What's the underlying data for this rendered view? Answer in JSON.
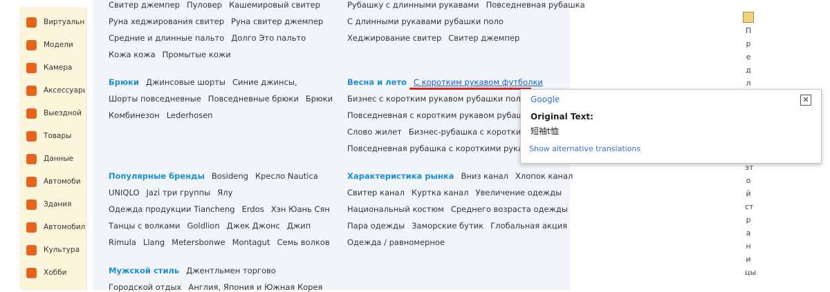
{
  "sidebar": [
    "Виртуальн",
    "Модели",
    "Камера",
    "Аксессуары",
    "Выездной",
    "Товары",
    "Данные",
    "Автомоби",
    "Здания",
    "Автомобили",
    "Культура",
    "Хобби"
  ],
  "main": {
    "left_rows": [
      [
        "Свитер джемпер",
        "Пуловер",
        "Кашемировый свитер"
      ],
      [
        "Руна хеджирования свитер",
        "Руна свитер джемпер"
      ],
      [
        "Средние и длинные пальто",
        "Долго Это пальто"
      ],
      [
        "Кожа кожа",
        "Промытые кожи"
      ],
      [
        "Брюки",
        "Джинсовые шорты",
        "Синие джинсы,"
      ],
      [
        "Шорты повседневные",
        "Повседневные брюки",
        "Брюки"
      ],
      [
        "Комбинезон",
        "Lederhosen"
      ],
      [
        "Популярные бренды",
        "Bosideng",
        "Кресло Nautica"
      ],
      [
        "UNIQLO",
        "Jazi три группы",
        "Ялу"
      ],
      [
        "Одежда продукции Tiancheng",
        "Erdos",
        "Хэн Юань Сян"
      ],
      [
        "Танцы с волками",
        "Goldlion",
        "Джек Джонс",
        "Джип"
      ],
      [
        "Rimula",
        "Llang",
        "Metersbonwe",
        "Montagut",
        "Семь волков"
      ],
      [
        "Мужской стиль",
        "Джентльмен торгово"
      ],
      [
        "Городской отдых",
        "Англия, Япония и Южная Корея"
      ]
    ],
    "right_rows": [
      [
        "Рубашку с длинными рукавами",
        "Повседневная рубашка"
      ],
      [
        "С длинными рукавами рубашки поло"
      ],
      [
        "Хеджирование свитер",
        "Свитер джемпер"
      ],
      [
        "Весна и лето",
        "С коротким рукавом футболки"
      ],
      [
        "Бизнес с коротким рукавом рубашки поло"
      ],
      [
        "Повседневная с коротким рукавом рубашки"
      ],
      [
        "Слово жилет",
        "Бизнес-рубашка с коротким"
      ],
      [
        "Повседневная рубашка с короткими рукавами"
      ],
      [
        "Характеристика рынка",
        "Вниз канал",
        "Хлопок канал"
      ],
      [
        "Свитер канал",
        "Куртка канал",
        "Увеличение одежды"
      ],
      [
        "Национальный костюм",
        "Среднего возраста одежды"
      ],
      [
        "Пара одежды",
        "Заморские бутик",
        "Глобальная акция"
      ],
      [
        "Одежда / равномерное"
      ]
    ]
  },
  "translate_popup": {
    "logo": "Google",
    "title": "Original Text:",
    "original": "短袖t恤",
    "alt_link": "Show alternative translations",
    "close": "✕"
  },
  "right_strip": {
    "top_chars": [
      "П",
      "р",
      "е",
      "д",
      "л"
    ],
    "bottom_chars": [
      "эт",
      "о",
      "й",
      "ст",
      "р",
      "а",
      "н",
      "и",
      "цы"
    ]
  }
}
